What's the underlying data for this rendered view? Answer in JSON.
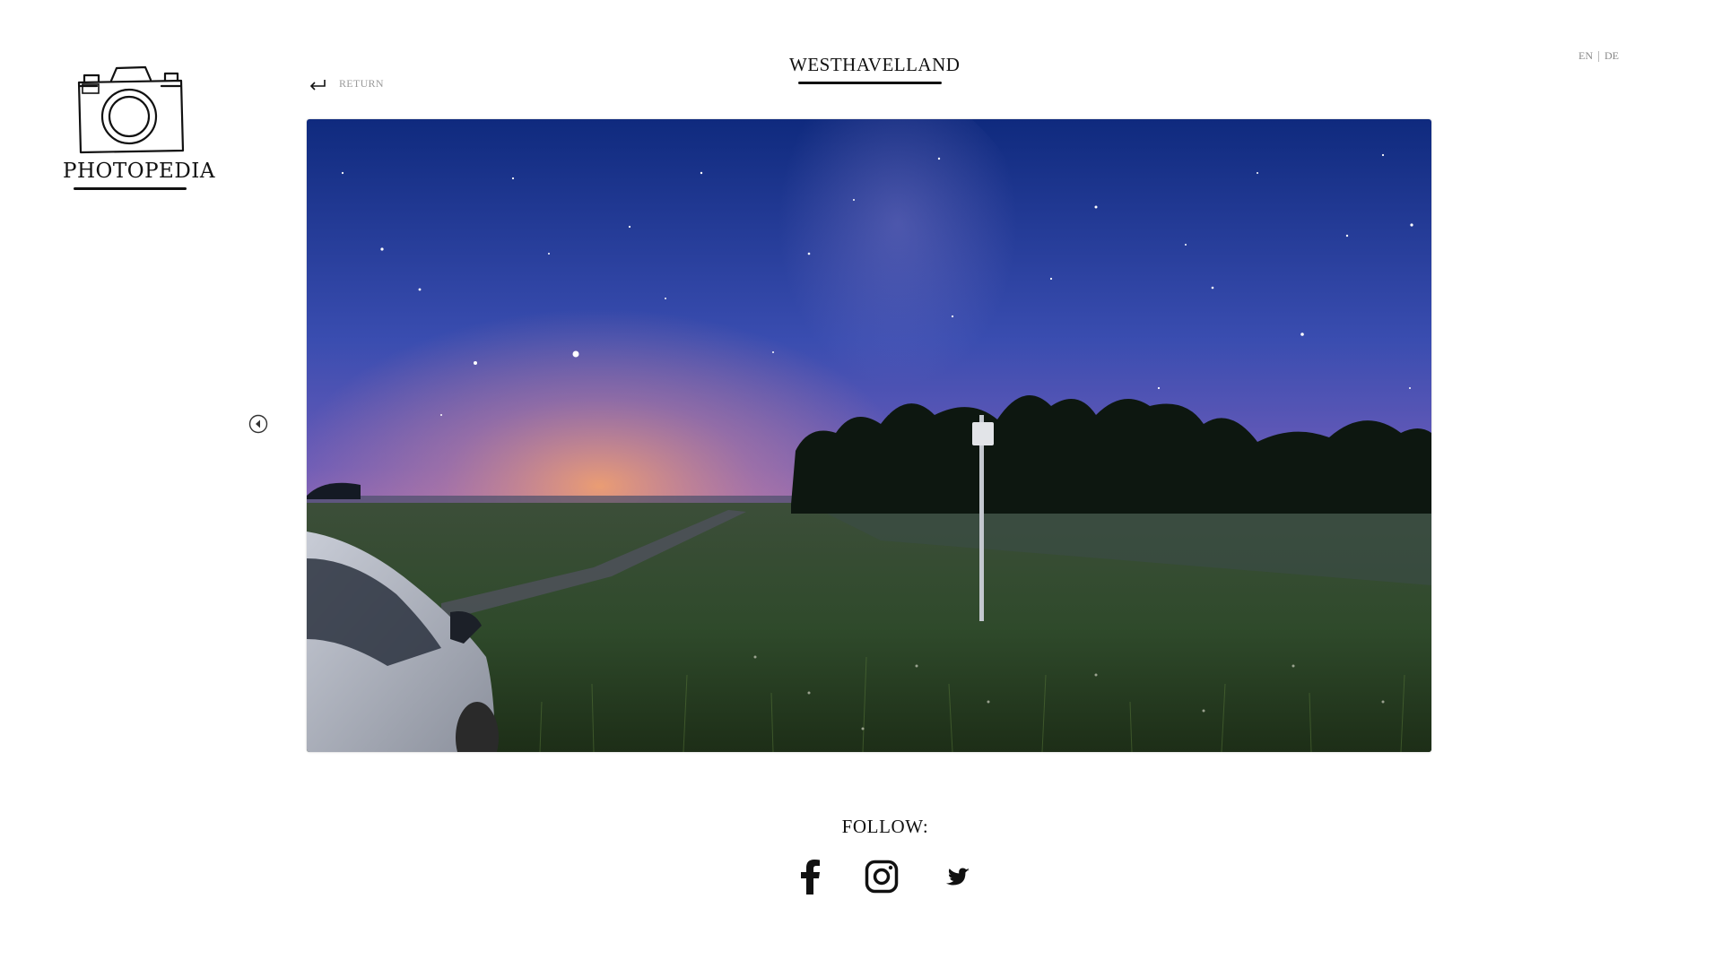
{
  "brand": {
    "name": "PHOTOPEDIA",
    "logo_icon": "camera-icon"
  },
  "nav": {
    "return_label": "RETURN",
    "return_icon": "return-arrow-icon"
  },
  "page": {
    "title": "WESTHAVELLAND"
  },
  "language": {
    "options": [
      "EN",
      "DE"
    ]
  },
  "gallery": {
    "prev_icon": "chevron-left-circle-icon",
    "photo_subject": "night-sky-over-meadow-photo"
  },
  "footer": {
    "follow_label": "FOLLOW:",
    "social": [
      {
        "name": "facebook",
        "icon": "facebook-icon"
      },
      {
        "name": "instagram",
        "icon": "instagram-icon"
      },
      {
        "name": "twitter",
        "icon": "twitter-icon"
      }
    ]
  },
  "colors": {
    "text": "#111111",
    "muted": "#9a9a9a",
    "sky_top": "#1a2f8a",
    "sky_mid": "#4a4fb0",
    "horizon_glow": "#e89a7a"
  }
}
